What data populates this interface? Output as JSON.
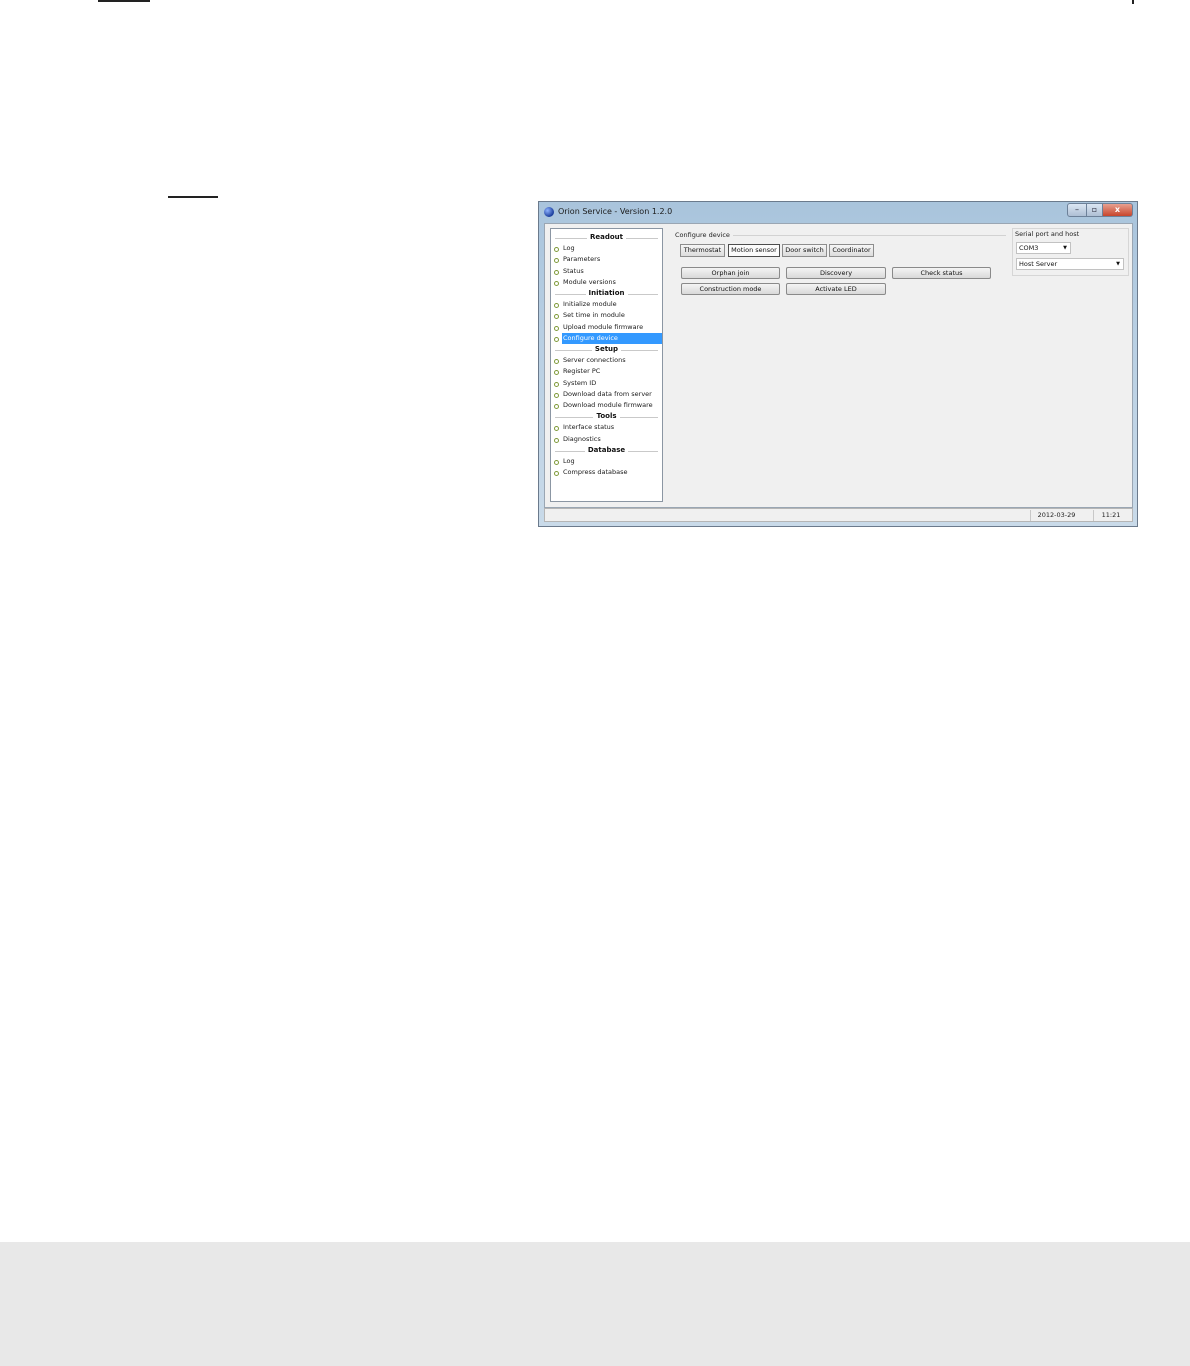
{
  "window": {
    "title": "Orion Service - Version 1.2.0",
    "close_glyph": "x"
  },
  "navigation": {
    "sections": [
      {
        "header": "Readout",
        "items": [
          "Log",
          "Parameters",
          "Status",
          "Module versions"
        ]
      },
      {
        "header": "Initiation",
        "items": [
          "Initialize module",
          "Set time in module",
          "Upload module firmware",
          "Configure device"
        ]
      },
      {
        "header": "Setup",
        "items": [
          "Server connections",
          "Register PC",
          "System ID",
          "Download data from server",
          "Download module firmware"
        ]
      },
      {
        "header": "Tools",
        "items": [
          "Interface status",
          "Diagnostics"
        ]
      },
      {
        "header": "Database",
        "items": [
          "Log",
          "Compress database"
        ]
      }
    ],
    "selected_item": "Configure device"
  },
  "configure": {
    "group_title": "Configure device",
    "device_tabs": [
      "Thermostat",
      "Motion sensor",
      "Door switch",
      "Coordinator"
    ],
    "active_tab": "Motion sensor",
    "actions": {
      "orphan_join": "Orphan join",
      "discovery": "Discovery",
      "check_status": "Check status",
      "construction_mode": "Construction mode",
      "activate_led": "Activate LED"
    }
  },
  "serial": {
    "group_title": "Serial port and host",
    "port_value": "COM3",
    "host_value": "Host Server"
  },
  "statusbar": {
    "date": "2012-03-29",
    "time": "11:21"
  },
  "colors": {
    "selection": "#3399ff",
    "titlebar": "#b8cfe3",
    "client_bg": "#f0f0f0"
  }
}
